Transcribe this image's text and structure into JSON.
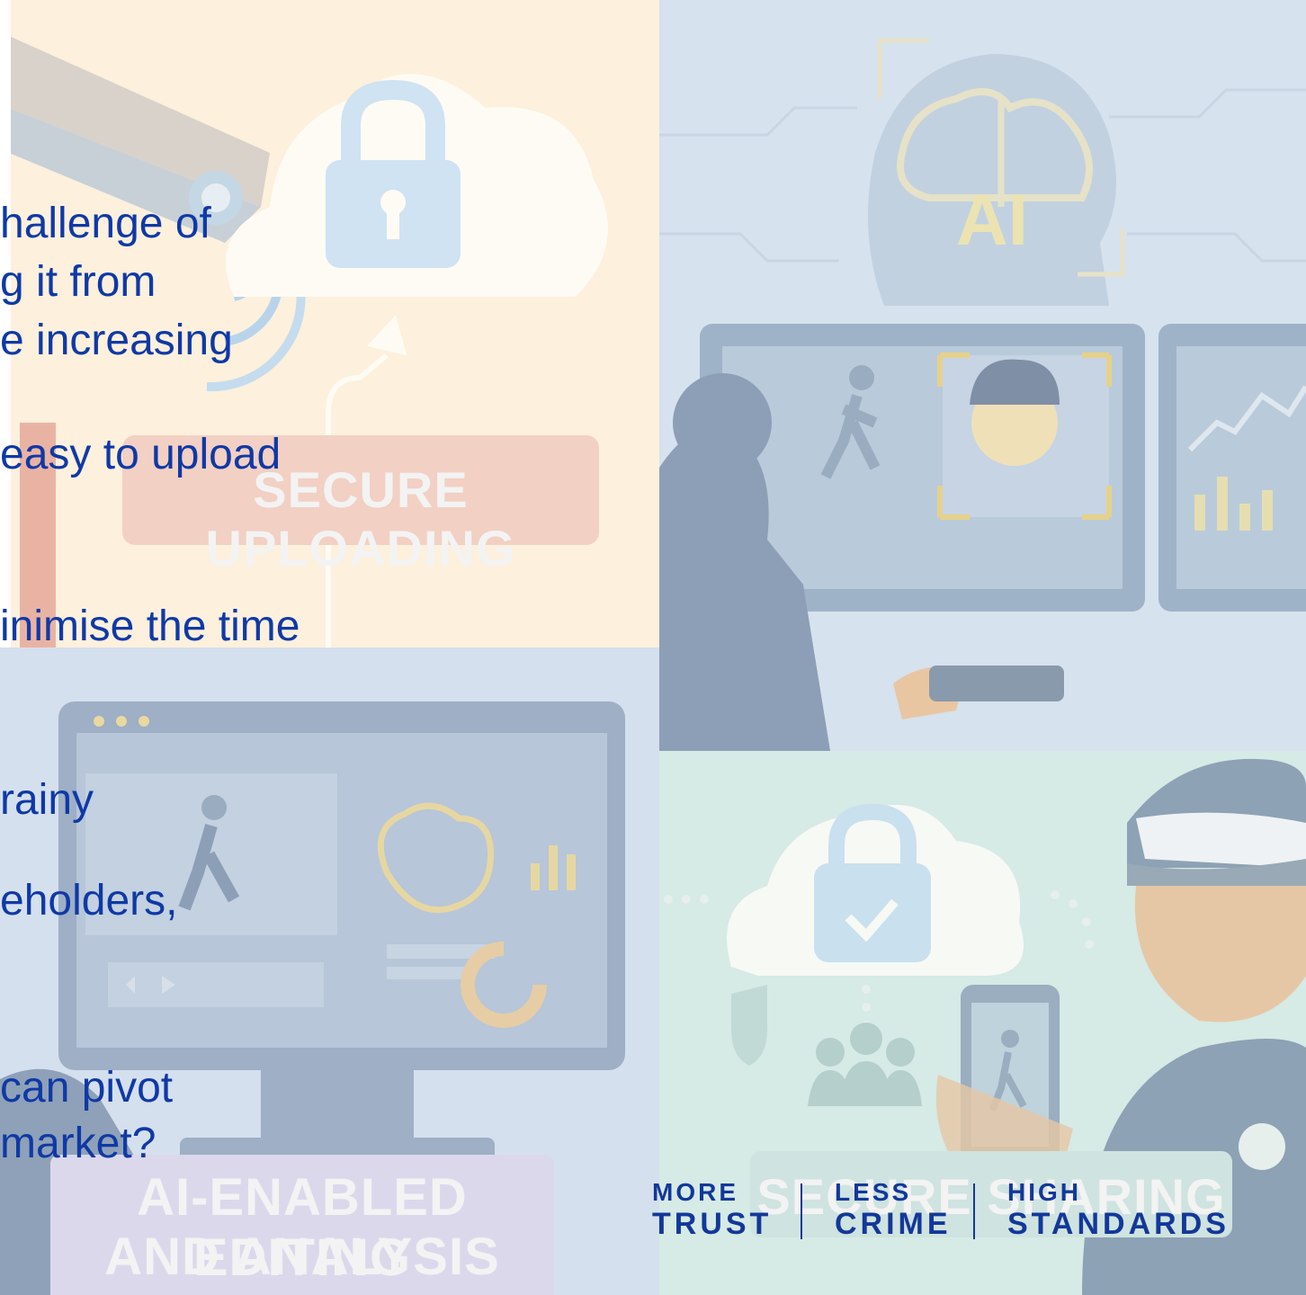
{
  "colors": {
    "text_blue": "#0f39a6",
    "brand_navy": "#13389a",
    "upload_panel_bg": "#fdf0dc",
    "ai_panel_bg": "#d6e2ee",
    "editing_panel_bg": "#d5e0ee",
    "sharing_panel_bg": "#d6eae6"
  },
  "images": {
    "cctv_camera": "cctv-camera-icon",
    "cloud_lock": "cloud-lock-icon",
    "ai_brain": "ai-brain-icon",
    "officer": "officer-at-monitor-icon",
    "editing_monitor": "editing-monitor-icon",
    "police_officer": "police-officer-icon",
    "phone": "smartphone-icon"
  },
  "banners": {
    "upload": "SECURE UPLOADING",
    "editing_line1": "AI-ENABLED EDITING",
    "editing_line2": "AND ANALYSIS",
    "sharing": "SECURE SHARING"
  },
  "slide_text": [
    "hallenge of",
    "g it from",
    "e increasing",
    "easy to upload",
    "inimise the time",
    "rainy",
    "eholders,",
    "can pivot",
    "market?"
  ],
  "brand": {
    "more": "MORE",
    "trust": "TRUST",
    "less": "LESS",
    "crime": "CRIME",
    "high": "HIGH",
    "standards": "STANDARDS"
  }
}
